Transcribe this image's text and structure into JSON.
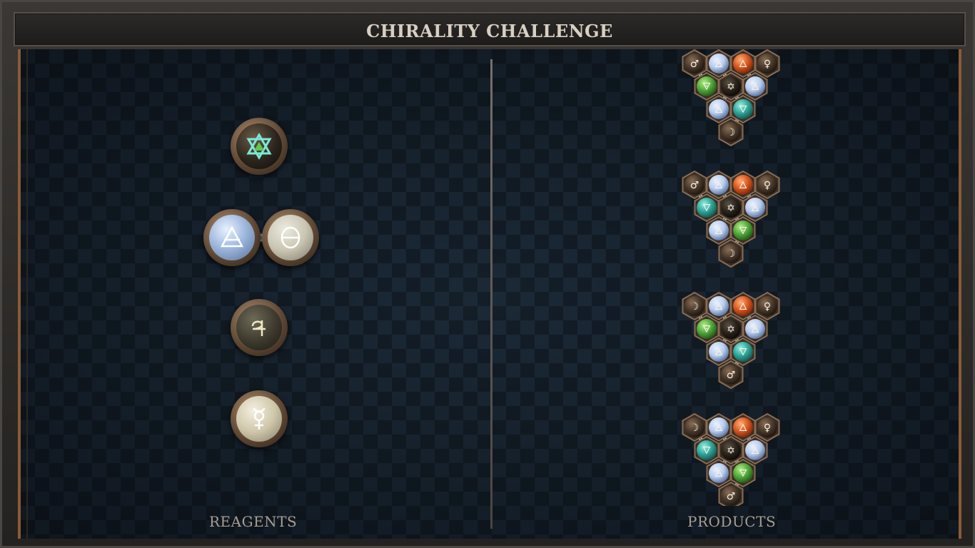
{
  "title": "CHIRALITY CHALLENGE",
  "reagents_label": "REAGENTS",
  "products_label": "PRODUCTS",
  "reagents": [
    {
      "symbols": [
        "✡"
      ],
      "kind": "salt"
    },
    {
      "symbols": [
        "🜁",
        "θ"
      ],
      "kind": "air-salt-pair"
    },
    {
      "symbols": [
        "♃"
      ],
      "kind": "lead"
    },
    {
      "symbols": [
        "☿"
      ],
      "kind": "quicksilver"
    }
  ],
  "products": [
    {
      "top": [
        "♂",
        "🜁",
        "🜂",
        "♀"
      ],
      "middle": [
        "🜃",
        "✡",
        "🜁"
      ],
      "lower": [
        "🜁",
        "🜄"
      ],
      "bottom": "☽"
    },
    {
      "top": [
        "♂",
        "🜁",
        "🜂",
        "♀"
      ],
      "middle": [
        "🜄",
        "✡",
        "🜁"
      ],
      "lower": [
        "🜁",
        "🜃"
      ],
      "bottom": "☽"
    },
    {
      "top": [
        "☽",
        "🜁",
        "🜂",
        "♀"
      ],
      "middle": [
        "🜃",
        "✡",
        "🜁"
      ],
      "lower": [
        "🜁",
        "🜄"
      ],
      "bottom": "♂"
    },
    {
      "top": [
        "☽",
        "🜁",
        "🜂",
        "♀"
      ],
      "middle": [
        "🜄",
        "✡",
        "🜁"
      ],
      "lower": [
        "🜁",
        "🜃"
      ],
      "bottom": "♂"
    }
  ],
  "colors": {
    "air": "#b9cdee",
    "fire": "#d8561e",
    "earth": "#4fa83a",
    "water": "#2fa59a",
    "metal": "#4a3a2c",
    "accent_frame": "#8b5a35"
  }
}
